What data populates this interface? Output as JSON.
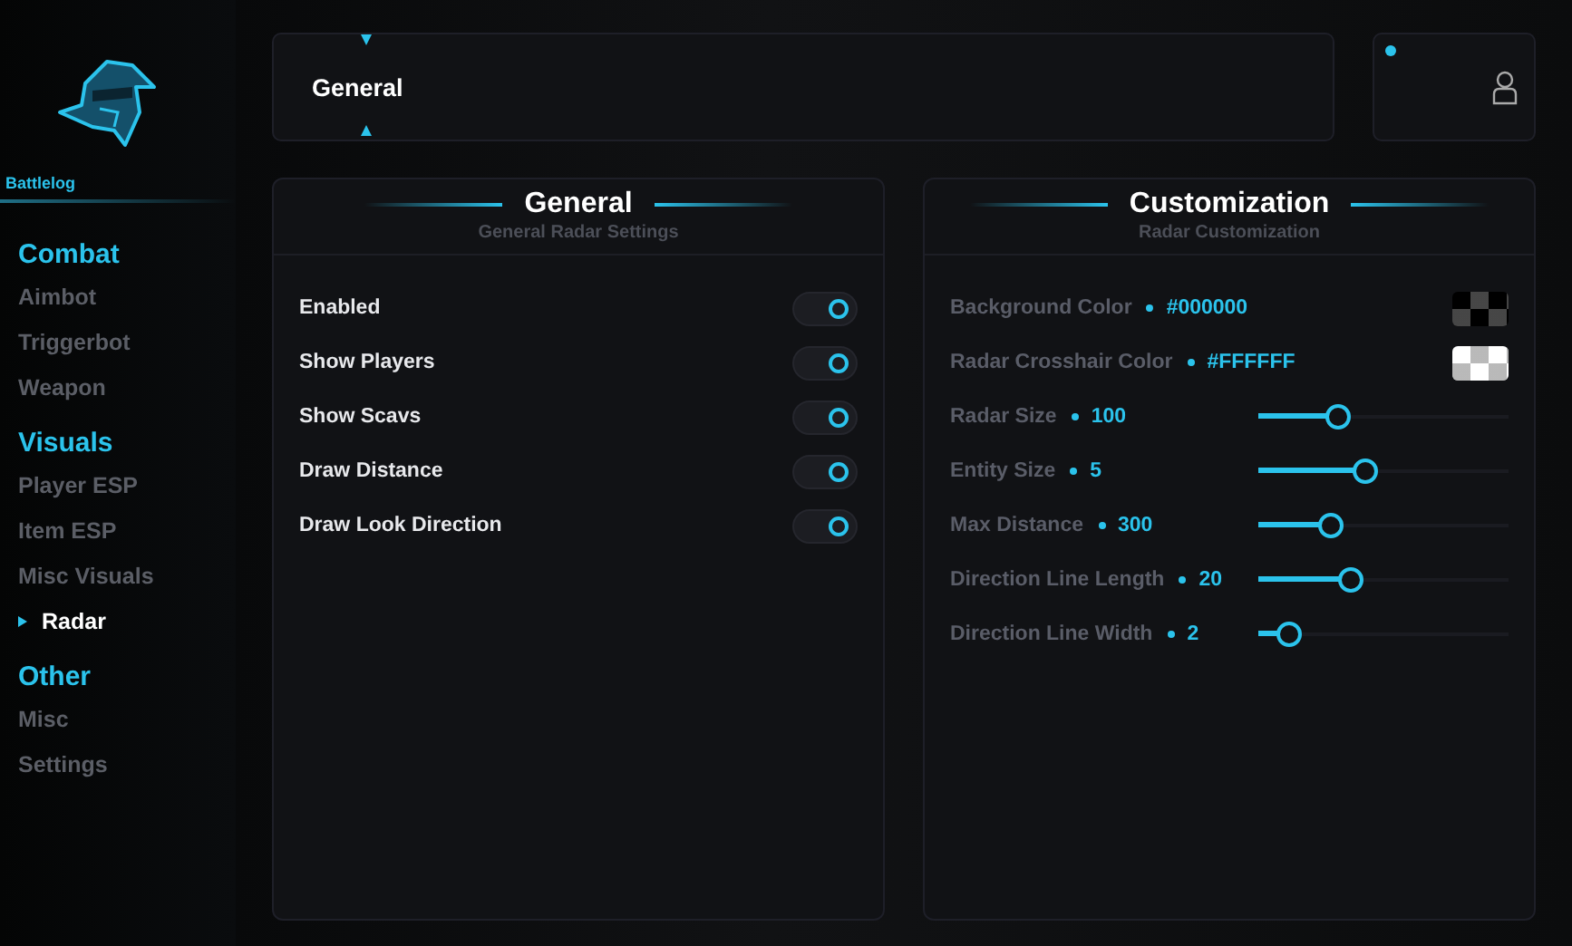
{
  "sidebar": {
    "brand": "Battlelog",
    "groups": [
      {
        "title": "Combat",
        "items": [
          {
            "label": "Aimbot",
            "selected": false
          },
          {
            "label": "Triggerbot",
            "selected": false
          },
          {
            "label": "Weapon",
            "selected": false
          }
        ]
      },
      {
        "title": "Visuals",
        "items": [
          {
            "label": "Player ESP",
            "selected": false
          },
          {
            "label": "Item ESP",
            "selected": false
          },
          {
            "label": "Misc Visuals",
            "selected": false
          },
          {
            "label": "Radar",
            "selected": true
          }
        ]
      },
      {
        "title": "Other",
        "items": [
          {
            "label": "Misc",
            "selected": false
          },
          {
            "label": "Settings",
            "selected": false
          }
        ]
      }
    ]
  },
  "topbar": {
    "title": "General"
  },
  "panels": [
    {
      "title": "General",
      "subtitle": "General Radar Settings",
      "rows": [
        {
          "kind": "toggle",
          "label": "Enabled",
          "on": true
        },
        {
          "kind": "toggle",
          "label": "Show Players",
          "on": true
        },
        {
          "kind": "toggle",
          "label": "Show Scavs",
          "on": true
        },
        {
          "kind": "toggle",
          "label": "Draw Distance",
          "on": true
        },
        {
          "kind": "toggle",
          "label": "Draw Look Direction",
          "on": true
        }
      ]
    },
    {
      "title": "Customization",
      "subtitle": "Radar Customization",
      "rows": [
        {
          "kind": "color",
          "label": "Background Color",
          "value": "#000000"
        },
        {
          "kind": "color",
          "label": "Radar Crosshair Color",
          "value": "#FFFFFF"
        },
        {
          "kind": "slider",
          "label": "Radar Size",
          "value": "100",
          "level": 0.32
        },
        {
          "kind": "slider",
          "label": "Entity Size",
          "value": "5",
          "level": 0.43
        },
        {
          "kind": "slider",
          "label": "Max Distance",
          "value": "300",
          "level": 0.29
        },
        {
          "kind": "slider",
          "label": "Direction Line Length",
          "value": "20",
          "level": 0.37
        },
        {
          "kind": "slider",
          "label": "Direction Line Width",
          "value": "2",
          "level": 0.12
        }
      ]
    }
  ]
}
